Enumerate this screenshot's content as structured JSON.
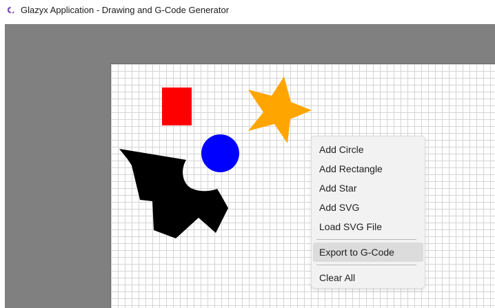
{
  "window": {
    "title": "Glazyx Application - Drawing and G-Code Generator",
    "icon": "app-logo-icon"
  },
  "colors": {
    "workspace_bg": "#808080",
    "rectangle_fill": "#ff0000",
    "circle_fill": "#0000ff",
    "star_fill": "#ffa500",
    "svg_fill": "#000000",
    "menu_bg": "#f2f2f2",
    "menu_highlight": "#dcdcdc"
  },
  "canvas": {
    "shapes": [
      {
        "kind": "rectangle",
        "color": "#ff0000"
      },
      {
        "kind": "circle",
        "color": "#0000ff"
      },
      {
        "kind": "star",
        "color": "#ffa500"
      },
      {
        "kind": "svg",
        "color": "#000000"
      }
    ]
  },
  "context_menu": {
    "items": [
      {
        "label": "Add Circle"
      },
      {
        "label": "Add Rectangle"
      },
      {
        "label": "Add Star"
      },
      {
        "label": "Add SVG"
      },
      {
        "label": "Load SVG File"
      },
      {
        "label": "Export to G-Code",
        "highlighted": true
      },
      {
        "label": "Clear All"
      }
    ]
  }
}
